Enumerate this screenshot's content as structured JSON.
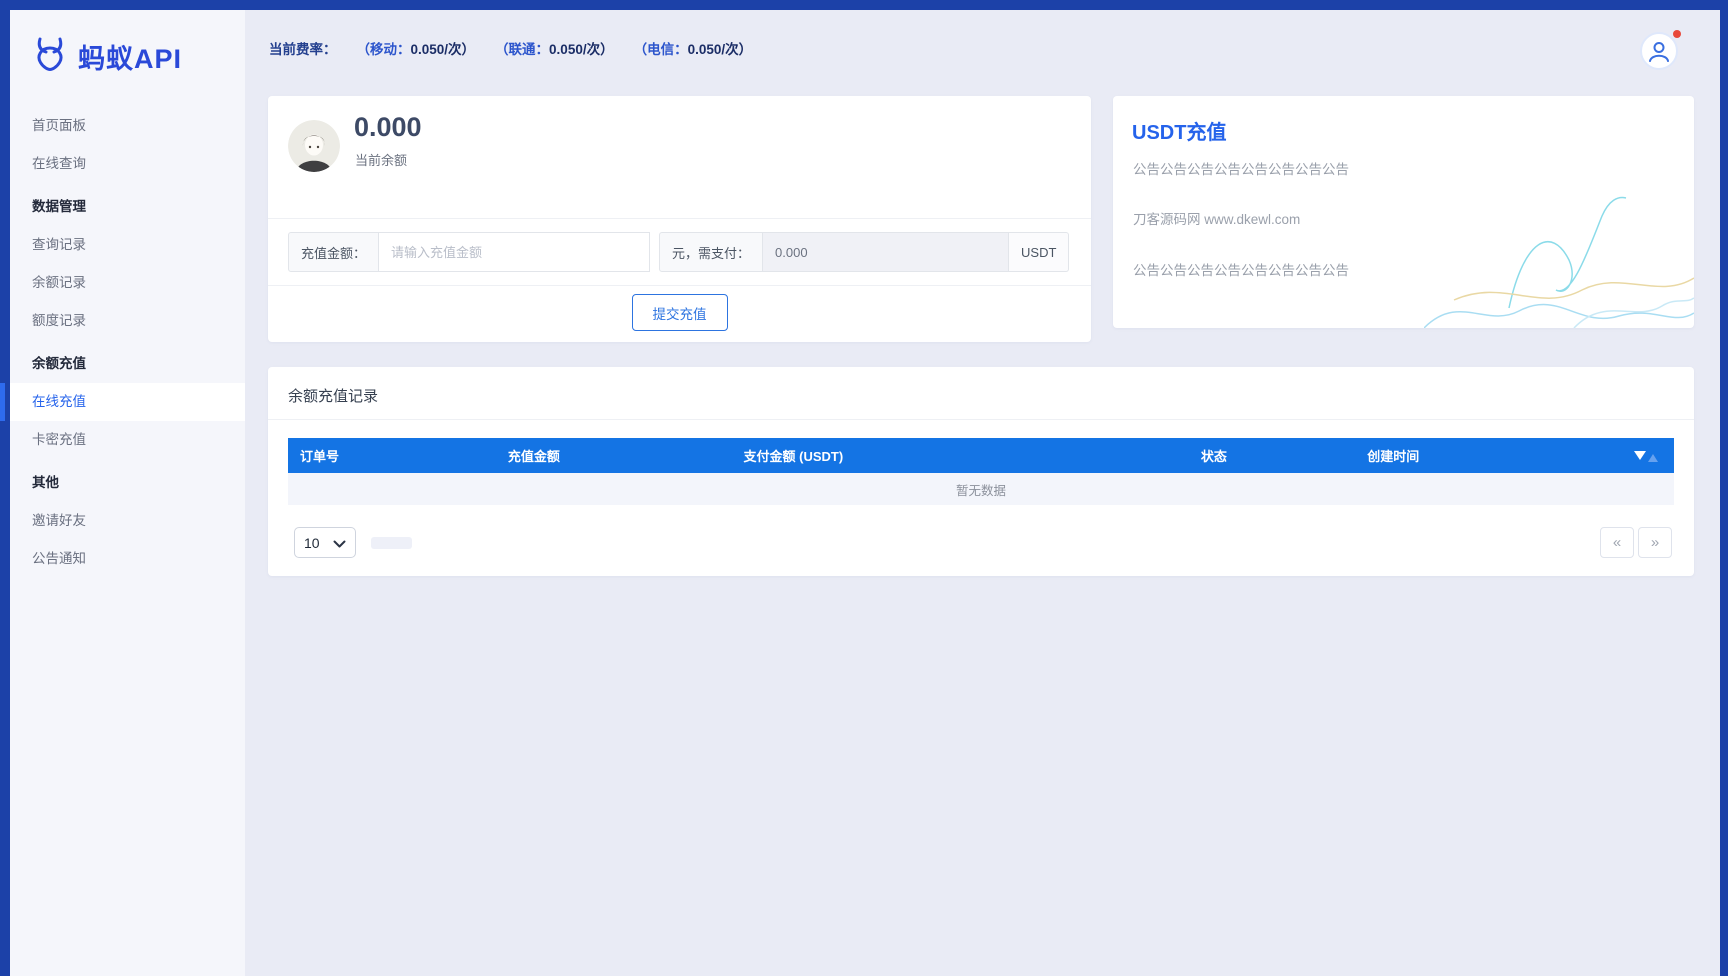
{
  "brand": {
    "name": "蚂蚁API",
    "logo_icon": "ant-icon",
    "color": "#2a49d8"
  },
  "topbar": {
    "rate_label": "当前费率：",
    "rates": [
      {
        "label": "（移动：",
        "value": "0.050/次）"
      },
      {
        "label": "（联通：",
        "value": "0.050/次）"
      },
      {
        "label": "（电信：",
        "value": "0.050/次）"
      }
    ],
    "user_icon": "user-icon",
    "notification_dot_color": "#e8483a"
  },
  "sidebar": {
    "items": [
      {
        "label": "首页面板",
        "type": "link"
      },
      {
        "label": "在线查询",
        "type": "link"
      },
      {
        "label": "数据管理",
        "type": "section"
      },
      {
        "label": "查询记录",
        "type": "link"
      },
      {
        "label": "余额记录",
        "type": "link"
      },
      {
        "label": "额度记录",
        "type": "link"
      },
      {
        "label": "余额充值",
        "type": "section"
      },
      {
        "label": "在线充值",
        "type": "link",
        "active": true
      },
      {
        "label": "卡密充值",
        "type": "link"
      },
      {
        "label": "其他",
        "type": "section"
      },
      {
        "label": "邀请好友",
        "type": "link"
      },
      {
        "label": "公告通知",
        "type": "link"
      }
    ]
  },
  "balance_card": {
    "amount": "0.000",
    "amount_label": "当前余额",
    "avatar_icon": "cartoon-user-avatar",
    "recharge_form": {
      "amount_label": "充值金额：",
      "amount_placeholder": "请输入充值金额",
      "pay_label": "元，需支付：",
      "pay_value": "0.000",
      "currency": "USDT",
      "submit": "提交充值"
    }
  },
  "usdt_card": {
    "title": "USDT充值",
    "lines": [
      "公告公告公告公告公告公告公告公告",
      "刀客源码网 www.dkewl.com",
      "公告公告公告公告公告公告公告公告"
    ]
  },
  "records_card": {
    "title": "余额充值记录",
    "table": {
      "columns": [
        "订单号",
        "充值金额",
        "支付金额 (USDT)",
        "状态",
        "创建时间"
      ],
      "sort_icon": "filter-sort-icon",
      "empty_text": "暂无数据",
      "header_color": "#1474e4"
    },
    "pagination": {
      "page_size": "10",
      "page_size_chevron": "chevron-down-icon",
      "prev": "«",
      "next": "»"
    }
  }
}
